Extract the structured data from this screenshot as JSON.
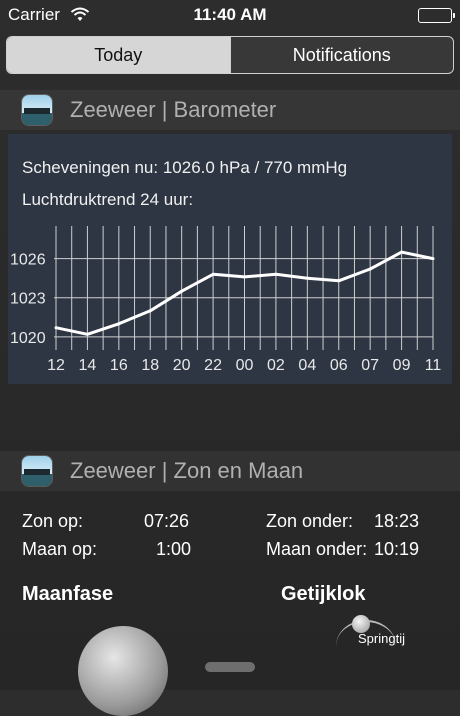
{
  "status_bar": {
    "carrier": "Carrier",
    "time": "11:40 AM"
  },
  "tabs": [
    {
      "label": "Today",
      "active": true
    },
    {
      "label": "Notifications",
      "active": false
    }
  ],
  "widgets": {
    "barometer": {
      "title": "Zeeweer | Barometer",
      "current_line": "Scheveningen nu: 1026.0 hPa / 770 mmHg",
      "trend_label": "Luchtdruktrend 24 uur:"
    },
    "sun_moon": {
      "title": "Zeeweer | Zon en Maan",
      "rows": [
        {
          "label": "Zon op:",
          "value": "07:26",
          "label2": "Zon onder:",
          "value2": "18:23"
        },
        {
          "label": "Maan op:",
          "value": "1:00",
          "label2": "Maan onder:",
          "value2": "10:19"
        }
      ],
      "moonphase_title": "Maanfase",
      "tideclock_title": "Getijklok",
      "tide_label": "Springtij"
    }
  },
  "chart_data": {
    "type": "line",
    "categories": [
      "12",
      "14",
      "16",
      "18",
      "20",
      "22",
      "00",
      "02",
      "04",
      "06",
      "07",
      "09",
      "11"
    ],
    "y_ticks": [
      1026,
      1023,
      1020
    ],
    "ylim": [
      1019.3,
      1028.5
    ],
    "grid": true,
    "series": [
      {
        "values": [
          1020.7,
          1020.2,
          1021.0,
          1022.0,
          1023.5,
          1024.8,
          1024.6,
          1024.8,
          1024.5,
          1024.3,
          1025.2,
          1026.5,
          1026.0
        ]
      }
    ],
    "colors": {
      "line": "#ffffff",
      "grid": "#cfcfcf",
      "panel": "#2e3643"
    }
  }
}
